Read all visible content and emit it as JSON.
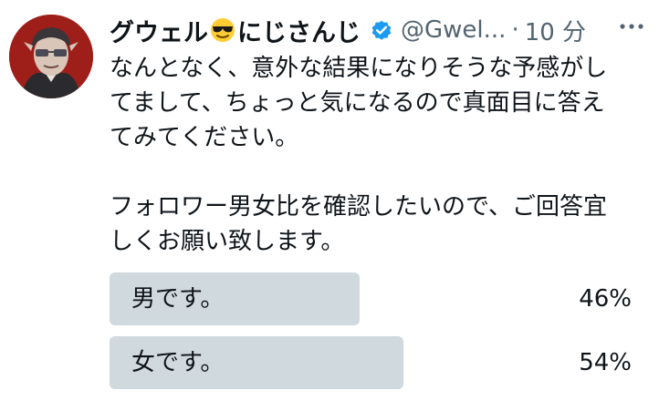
{
  "tweet": {
    "author_name_part1": "グウェル",
    "author_name_emoji": "smiling-face-with-sunglasses-icon",
    "author_name_part2": "にじさんじ",
    "handle": "@Gwel...",
    "separator": "·",
    "time": "10 分",
    "verified_color": "#1d9bf0",
    "text_lines": [
      "なんとなく、意外な結果になりそうな予感がし",
      "てまして、ちょっと気になるので真面目に答え",
      "てみてください。",
      "",
      "フォロワー男女比を確認したいので、ご回答宜",
      "しくお願い致します。"
    ]
  },
  "poll": {
    "options": [
      {
        "label": "男です。",
        "percent_label": "46%",
        "percent": 46
      },
      {
        "label": "女です。",
        "percent_label": "54%",
        "percent": 54
      }
    ],
    "bar_color": "#cfd9de"
  }
}
